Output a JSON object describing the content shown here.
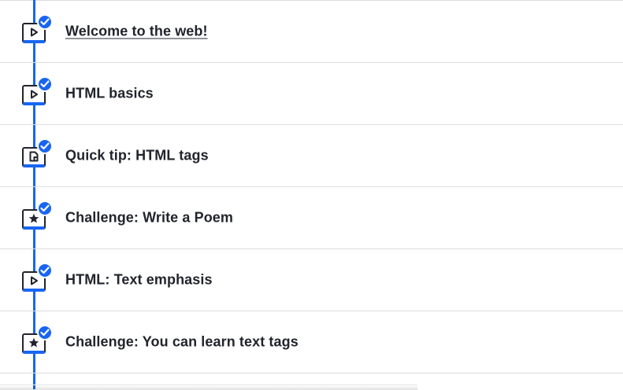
{
  "colors": {
    "accent": "#1865f2",
    "text": "#21242c",
    "divider": "#dcdde0"
  },
  "lessons": [
    {
      "label": "Welcome to the web!",
      "type": "video",
      "icon": "play-icon",
      "completed": true
    },
    {
      "label": "HTML basics",
      "type": "video",
      "icon": "play-icon",
      "completed": true
    },
    {
      "label": "Quick tip: HTML tags",
      "type": "article",
      "icon": "document-icon",
      "completed": true
    },
    {
      "label": "Challenge: Write a Poem",
      "type": "challenge",
      "icon": "star-icon",
      "completed": true
    },
    {
      "label": "HTML: Text emphasis",
      "type": "video",
      "icon": "play-icon",
      "completed": true
    },
    {
      "label": "Challenge: You can learn text tags",
      "type": "challenge",
      "icon": "star-icon",
      "completed": true
    }
  ]
}
